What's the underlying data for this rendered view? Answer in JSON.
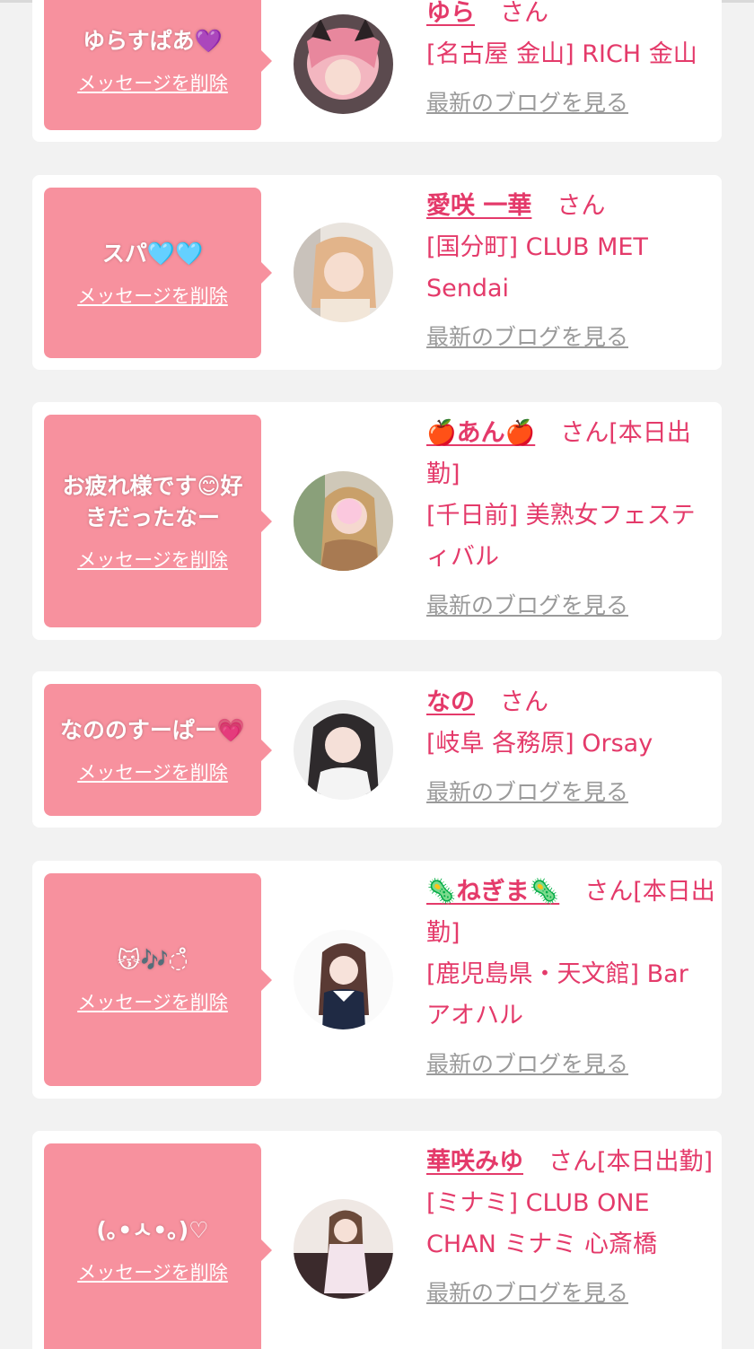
{
  "delete_label": "メッセージを削除",
  "blog_label": "最新のブログを見る",
  "san_label": "さん",
  "colors": {
    "bubble": "#f7919e",
    "name": "#e43a6a",
    "blog": "#9a9a9a",
    "background": "#f2f2f2"
  },
  "cards": [
    {
      "message": "ゆらすぱあ💜",
      "name": "ゆら",
      "san": "さん",
      "shop": "[名古屋 金山] RICH 金山",
      "avatar_icon": "avatar-photo-1"
    },
    {
      "message": "スパ🩵🩵",
      "name": "愛咲 一華",
      "san": "さん",
      "shop": "[国分町] CLUB MET Sendai",
      "avatar_icon": "avatar-photo-2"
    },
    {
      "message": "お疲れ様です😊好きだったなー",
      "name": "🍎あん🍎",
      "san": "さん[本日出勤]",
      "shop": "[千日前] 美熟女フェスティバル",
      "avatar_icon": "avatar-photo-3"
    },
    {
      "message": "なののすーぱー💗",
      "name": "なの",
      "san": "さん",
      "shop": "[岐阜 各務原] Orsay",
      "avatar_icon": "avatar-photo-4"
    },
    {
      "message": "😽🎶◌̊",
      "name": "🦠ねぎま🦠",
      "san": "さん[本日出勤]",
      "shop": "[鹿児島県・天文館] Bar アオハル",
      "avatar_icon": "avatar-photo-5"
    },
    {
      "message": "(｡•ㅅ•｡)♡",
      "name": "華咲みゆ",
      "san": "さん[本日出勤]",
      "shop": "[ミナミ] CLUB ONE CHAN ミナミ 心斎橋",
      "avatar_icon": "avatar-photo-6"
    }
  ]
}
